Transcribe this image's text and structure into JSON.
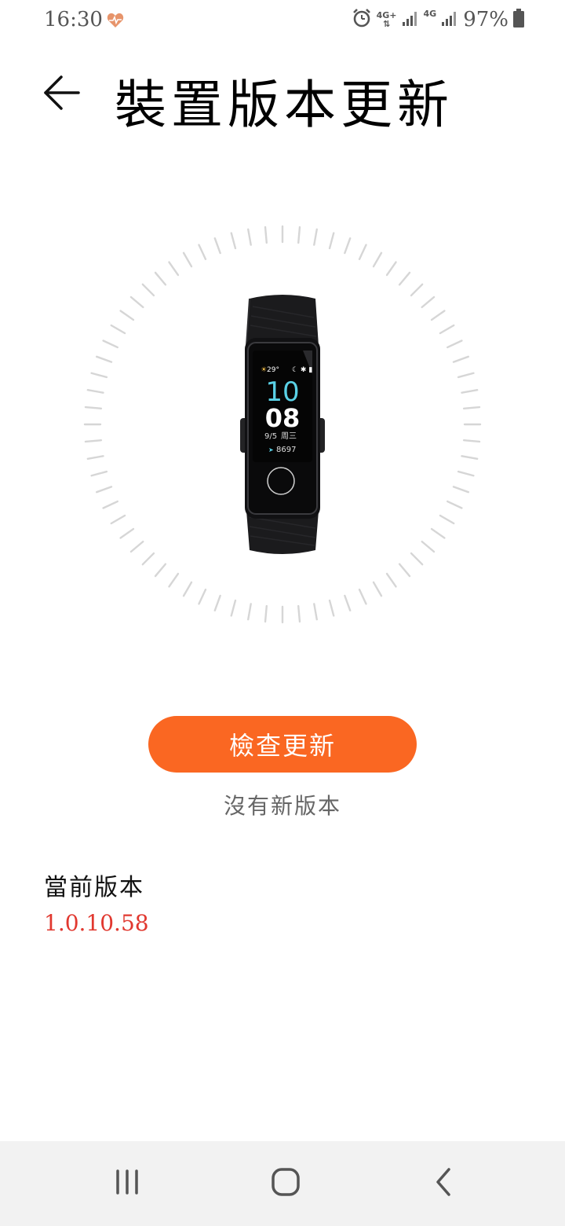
{
  "status_bar": {
    "time": "16:30",
    "network_1": "4G+",
    "network_2": "4G",
    "battery": "97%"
  },
  "header": {
    "title": "裝置版本更新"
  },
  "device": {
    "watch_temp": "29°",
    "watch_hour": "10",
    "watch_minute": "08",
    "watch_date": "9/5",
    "watch_weekday": "周三",
    "watch_steps": "8697"
  },
  "update": {
    "button_label": "檢查更新",
    "status_text": "沒有新版本"
  },
  "current_version": {
    "label": "當前版本",
    "value": "1.0.10.58"
  },
  "colors": {
    "accent": "#fa6722",
    "version": "#e1382f",
    "watch_hour": "#5ad1e6"
  },
  "icons": {
    "back": "arrow-left",
    "heart": "heart-pulse",
    "alarm": "alarm-clock",
    "signal": "signal-bars",
    "battery": "battery",
    "nav_recents": "recents-lines",
    "nav_home": "home-rounded-square",
    "nav_back": "chevron-left"
  }
}
